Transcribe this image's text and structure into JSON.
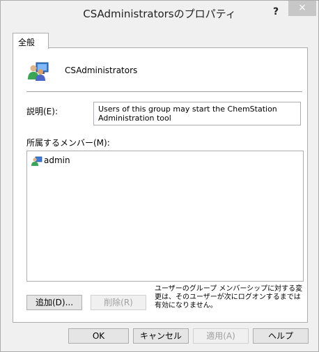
{
  "window": {
    "title": "CSAdministratorsのプロパティ",
    "help_label": "?",
    "close_label": "×"
  },
  "tabs": [
    {
      "label": "全般",
      "selected": true
    }
  ],
  "general": {
    "group_icon": "group-users-icon",
    "group_name": "CSAdministrators",
    "description_label": "説明(E):",
    "description_value": "Users of this group may start the ChemStation Administration tool",
    "members_label": "所属するメンバー(M):",
    "members": [
      {
        "icon": "user-icon",
        "name": "admin"
      }
    ],
    "add_button": "追加(D)...",
    "remove_button": "削除(R)",
    "note": "ユーザーのグループ メンバーシップに対する変更は、そのユーザーが次にログオンするまでは有効になりません。"
  },
  "footer": {
    "ok": "OK",
    "cancel": "キャンセル",
    "apply": "適用(A)",
    "help": "ヘルプ"
  },
  "colors": {
    "accent": "#3c7fb1",
    "close_bg": "#c7c7c7"
  }
}
